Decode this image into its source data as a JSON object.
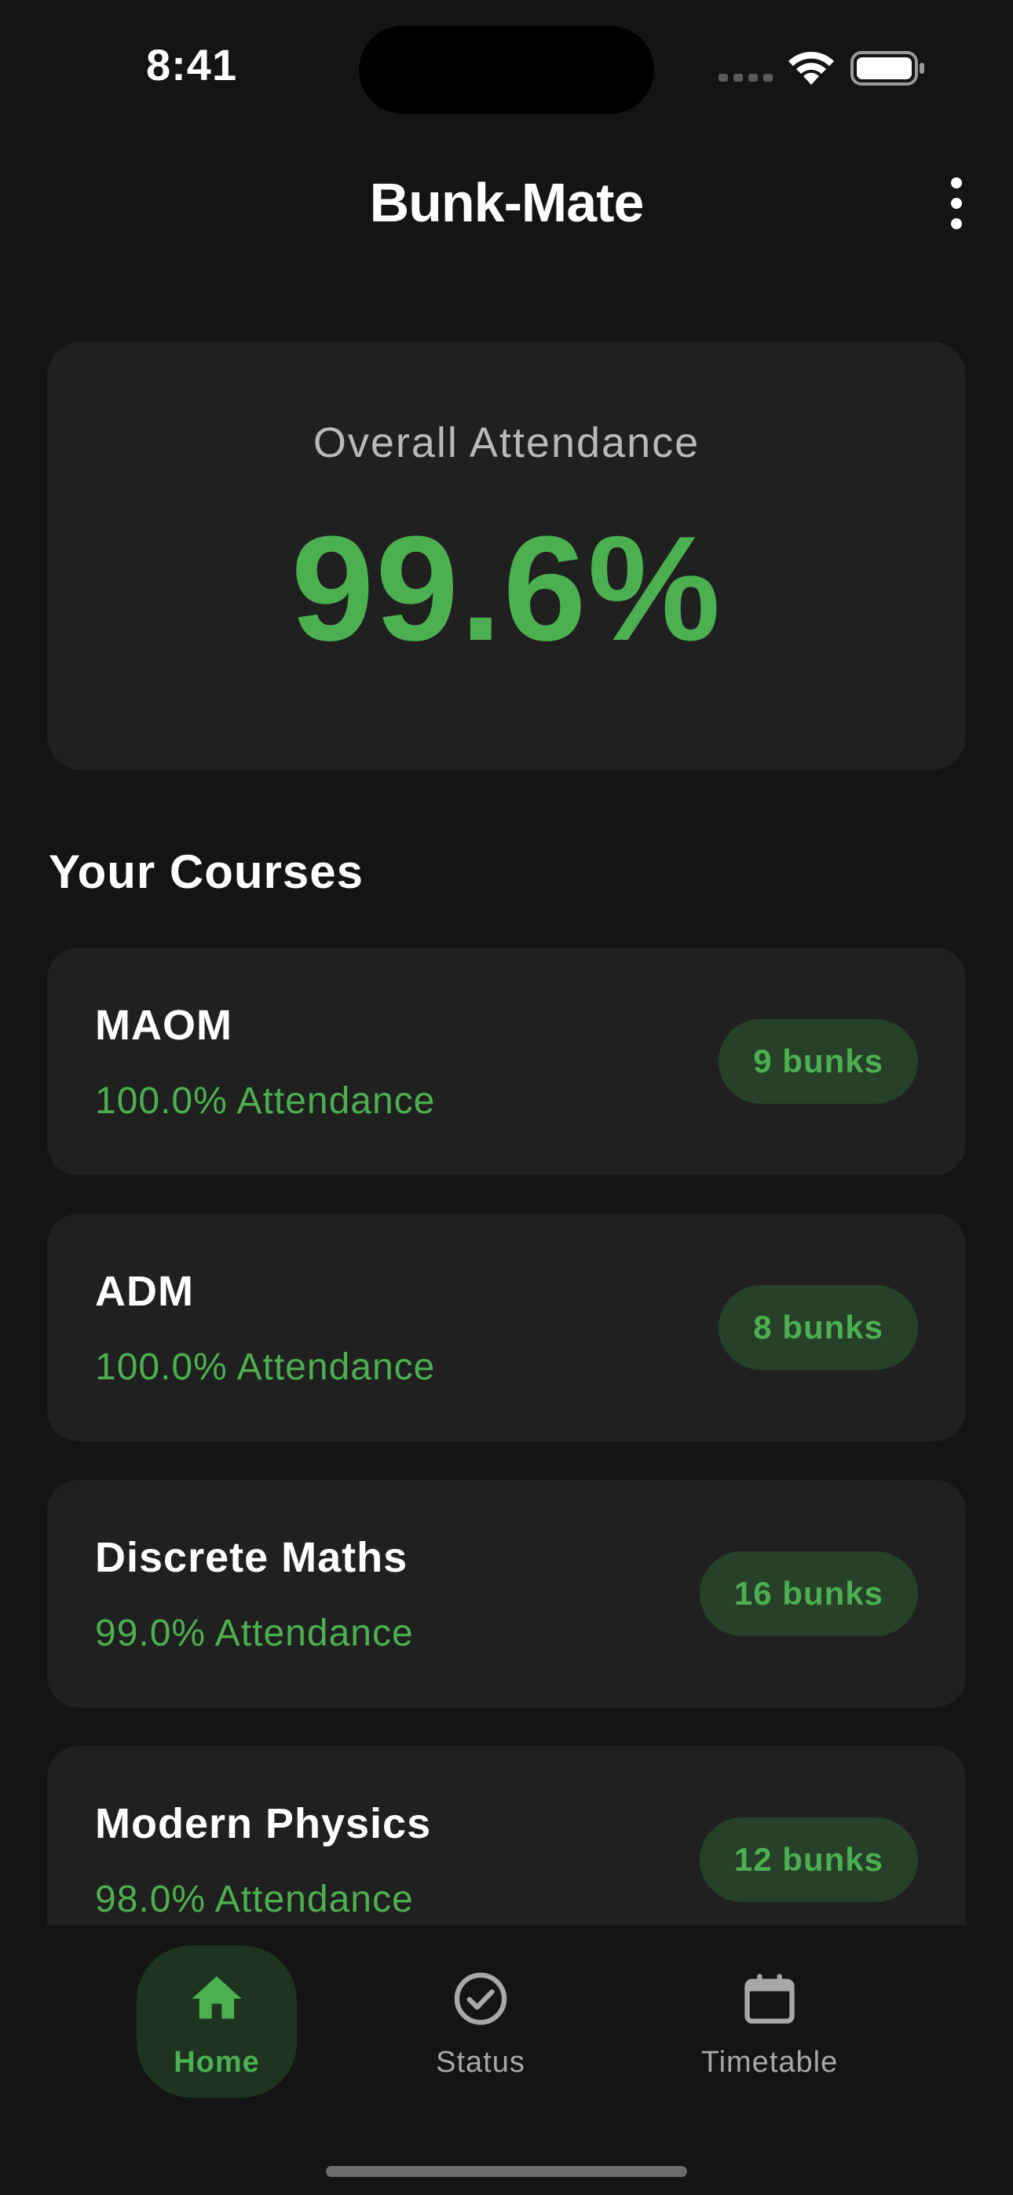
{
  "status_bar": {
    "time": "8:41"
  },
  "app_bar": {
    "title": "Bunk-Mate",
    "menu_icon": "more-vert-icon"
  },
  "overall": {
    "label": "Overall Attendance",
    "value": "99.6%",
    "color": "#4caf50"
  },
  "courses_section": {
    "title": "Your Courses",
    "items": [
      {
        "name": "MAOM",
        "attendance": "100.0% Attendance",
        "bunks": "9 bunks"
      },
      {
        "name": "ADM",
        "attendance": "100.0% Attendance",
        "bunks": "8 bunks"
      },
      {
        "name": "Discrete Maths",
        "attendance": "99.0% Attendance",
        "bunks": "16 bunks"
      },
      {
        "name": "Modern Physics",
        "attendance": "98.0% Attendance",
        "bunks": "12 bunks"
      }
    ]
  },
  "bottom_nav": {
    "items": [
      {
        "label": "Home",
        "icon": "home-icon",
        "active": true
      },
      {
        "label": "Status",
        "icon": "check-circle-icon",
        "active": false
      },
      {
        "label": "Timetable",
        "icon": "calendar-icon",
        "active": false
      }
    ]
  },
  "colors": {
    "background": "#141414",
    "card": "#202020",
    "accent": "#4caf50",
    "badge": "#26402a"
  }
}
